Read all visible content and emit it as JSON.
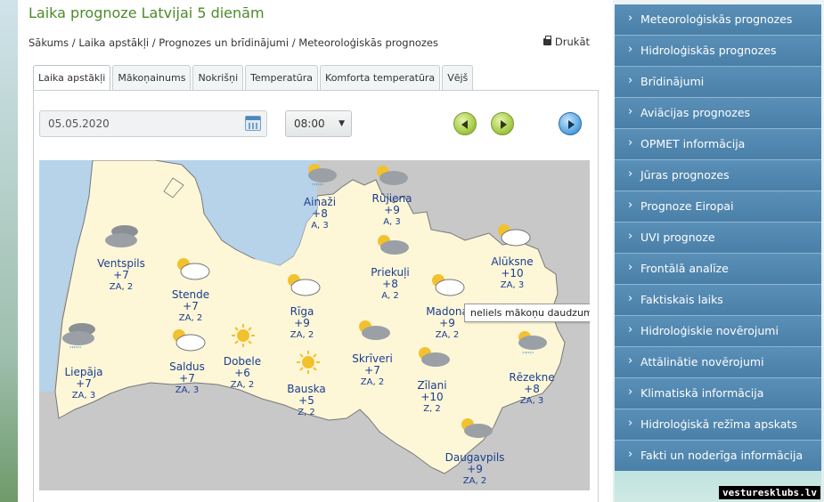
{
  "page": {
    "title": "Laika prognoze Latvijai 5 dienām",
    "print_label": "Drukāt",
    "watermark": "vesturesklubs.lv"
  },
  "breadcrumb": [
    "Sākums",
    "Laika apstākļi",
    "Prognozes un brīdinājumi",
    "Meteoroloģiskās prognozes"
  ],
  "tabs": [
    "Laika apstākļi",
    "Mākoņainums",
    "Nokrišņi",
    "Temperatūra",
    "Komforta temperatūra",
    "Vējš"
  ],
  "controls": {
    "date": "05.05.2020",
    "time": "08:00"
  },
  "tooltip": "neliels mākoņu daudzums",
  "cities": [
    {
      "name": "Ainaži",
      "temp": "+8",
      "wind": "A, 3",
      "icon": "cloudy-rain-icon"
    },
    {
      "name": "Rūjiena",
      "temp": "+9",
      "wind": "A, 3",
      "icon": "partly-cloudy-dark-icon"
    },
    {
      "name": "Ventspils",
      "temp": "+7",
      "wind": "ZA, 2",
      "icon": "overcast-icon"
    },
    {
      "name": "Stende",
      "temp": "+7",
      "wind": "ZA, 2",
      "icon": "partly-cloudy-icon"
    },
    {
      "name": "Priekuļi",
      "temp": "+8",
      "wind": "A, 2",
      "icon": "partly-cloudy-dark-icon"
    },
    {
      "name": "Alūksne",
      "temp": "+10",
      "wind": "ZA, 3",
      "icon": "partly-cloudy-icon"
    },
    {
      "name": "Rīga",
      "temp": "+9",
      "wind": "ZA, 2",
      "icon": "partly-cloudy-icon"
    },
    {
      "name": "Madona",
      "temp": "+9",
      "wind": "ZA, 2",
      "icon": "partly-cloudy-icon"
    },
    {
      "name": "Liepāja",
      "temp": "+7",
      "wind": "ZA, 3",
      "icon": "overcast-rain-icon"
    },
    {
      "name": "Saldus",
      "temp": "+7",
      "wind": "ZA, 3",
      "icon": "partly-cloudy-icon"
    },
    {
      "name": "Dobele",
      "temp": "+6",
      "wind": "ZA, 2",
      "icon": "sunny-icon"
    },
    {
      "name": "Bauska",
      "temp": "+5",
      "wind": "Z, 2",
      "icon": "sunny-icon"
    },
    {
      "name": "Skrīveri",
      "temp": "+7",
      "wind": "ZA, 2",
      "icon": "partly-cloudy-dark-icon"
    },
    {
      "name": "Zīlani",
      "temp": "+10",
      "wind": "Z, 2",
      "icon": "partly-cloudy-dark-icon"
    },
    {
      "name": "Rēzekne",
      "temp": "+8",
      "wind": "ZA, 3",
      "icon": "cloudy-rain-icon"
    },
    {
      "name": "Daugavpils",
      "temp": "+9",
      "wind": "ZA, 2",
      "icon": "partly-cloudy-dark-icon"
    }
  ],
  "sidebar": [
    "Meteoroloģiskās prognozes",
    "Hidroloģiskās prognozes",
    "Brīdinājumi",
    "Aviācijas prognozes",
    "OPMET informācija",
    "Jūras prognozes",
    "Prognoze Eiropai",
    "UVI prognoze",
    "Frontālā analīze",
    "Faktiskais laiks",
    "Hidroloģiskie novērojumi",
    "Attālinātie novērojumi",
    "Klimatiskā informācija",
    "Hidroloģiskā režīma apskats",
    "Fakti un noderīga informācija"
  ],
  "colors": {
    "title_green": "#4d8a2a",
    "sidebar_blue": "#4f86ae",
    "land": "#fdf7d8",
    "sea": "#b6d3ea",
    "text_blue": "#1b3d8f"
  }
}
